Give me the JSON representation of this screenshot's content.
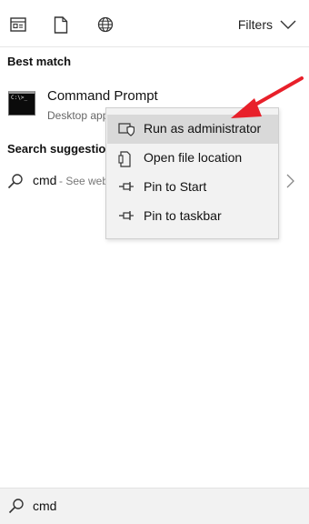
{
  "topbar": {
    "icons": [
      "apps-icon",
      "document-icon",
      "web-globe-icon"
    ],
    "filters_label": "Filters"
  },
  "best_match": {
    "section_label": "Best match",
    "item": {
      "title": "Command Prompt",
      "subtitle": "Desktop app",
      "icon": "command-prompt-icon",
      "icon_text": "C:\\>_"
    }
  },
  "suggestions": {
    "section_label": "Search suggestions",
    "items": [
      {
        "query": "cmd",
        "hint": "- See web results"
      }
    ]
  },
  "context_menu": {
    "items": [
      {
        "label": "Run as administrator",
        "icon": "shield-icon",
        "highlighted": true
      },
      {
        "label": "Open file location",
        "icon": "file-location-icon",
        "highlighted": false
      },
      {
        "label": "Pin to Start",
        "icon": "pin-icon",
        "highlighted": false
      },
      {
        "label": "Pin to taskbar",
        "icon": "pin-icon",
        "highlighted": false
      }
    ]
  },
  "annotation": {
    "arrow_color": "#e8202a"
  },
  "search": {
    "value": "cmd"
  }
}
